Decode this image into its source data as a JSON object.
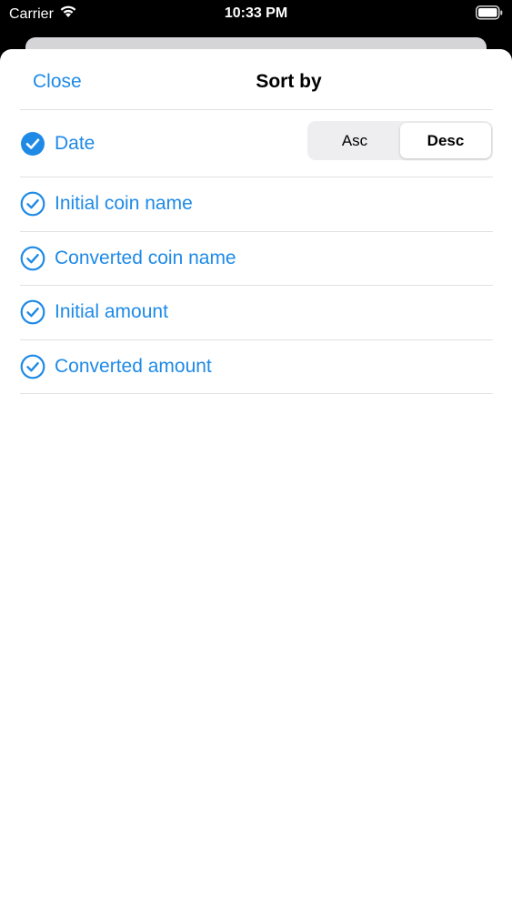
{
  "status_bar": {
    "carrier": "Carrier",
    "time": "10:33 PM",
    "wifi_icon": "wifi-icon",
    "battery_icon": "battery-icon"
  },
  "sheet": {
    "close_label": "Close",
    "title": "Sort by"
  },
  "sort_options": [
    {
      "label": "Date",
      "selected": true,
      "icon": "checkmark-circle-filled-icon"
    },
    {
      "label": "Initial coin name",
      "selected": false,
      "icon": "checkmark-circle-outline-icon"
    },
    {
      "label": "Converted coin name",
      "selected": false,
      "icon": "checkmark-circle-outline-icon"
    },
    {
      "label": "Initial amount",
      "selected": false,
      "icon": "checkmark-circle-outline-icon"
    },
    {
      "label": "Converted amount",
      "selected": false,
      "icon": "checkmark-circle-outline-icon"
    }
  ],
  "order_control": {
    "options": [
      "Asc",
      "Desc"
    ],
    "selected": "Desc"
  },
  "colors": {
    "accent": "#1e8ae6",
    "divider": "#e1e1e4",
    "segment_bg": "#eeeef0"
  }
}
